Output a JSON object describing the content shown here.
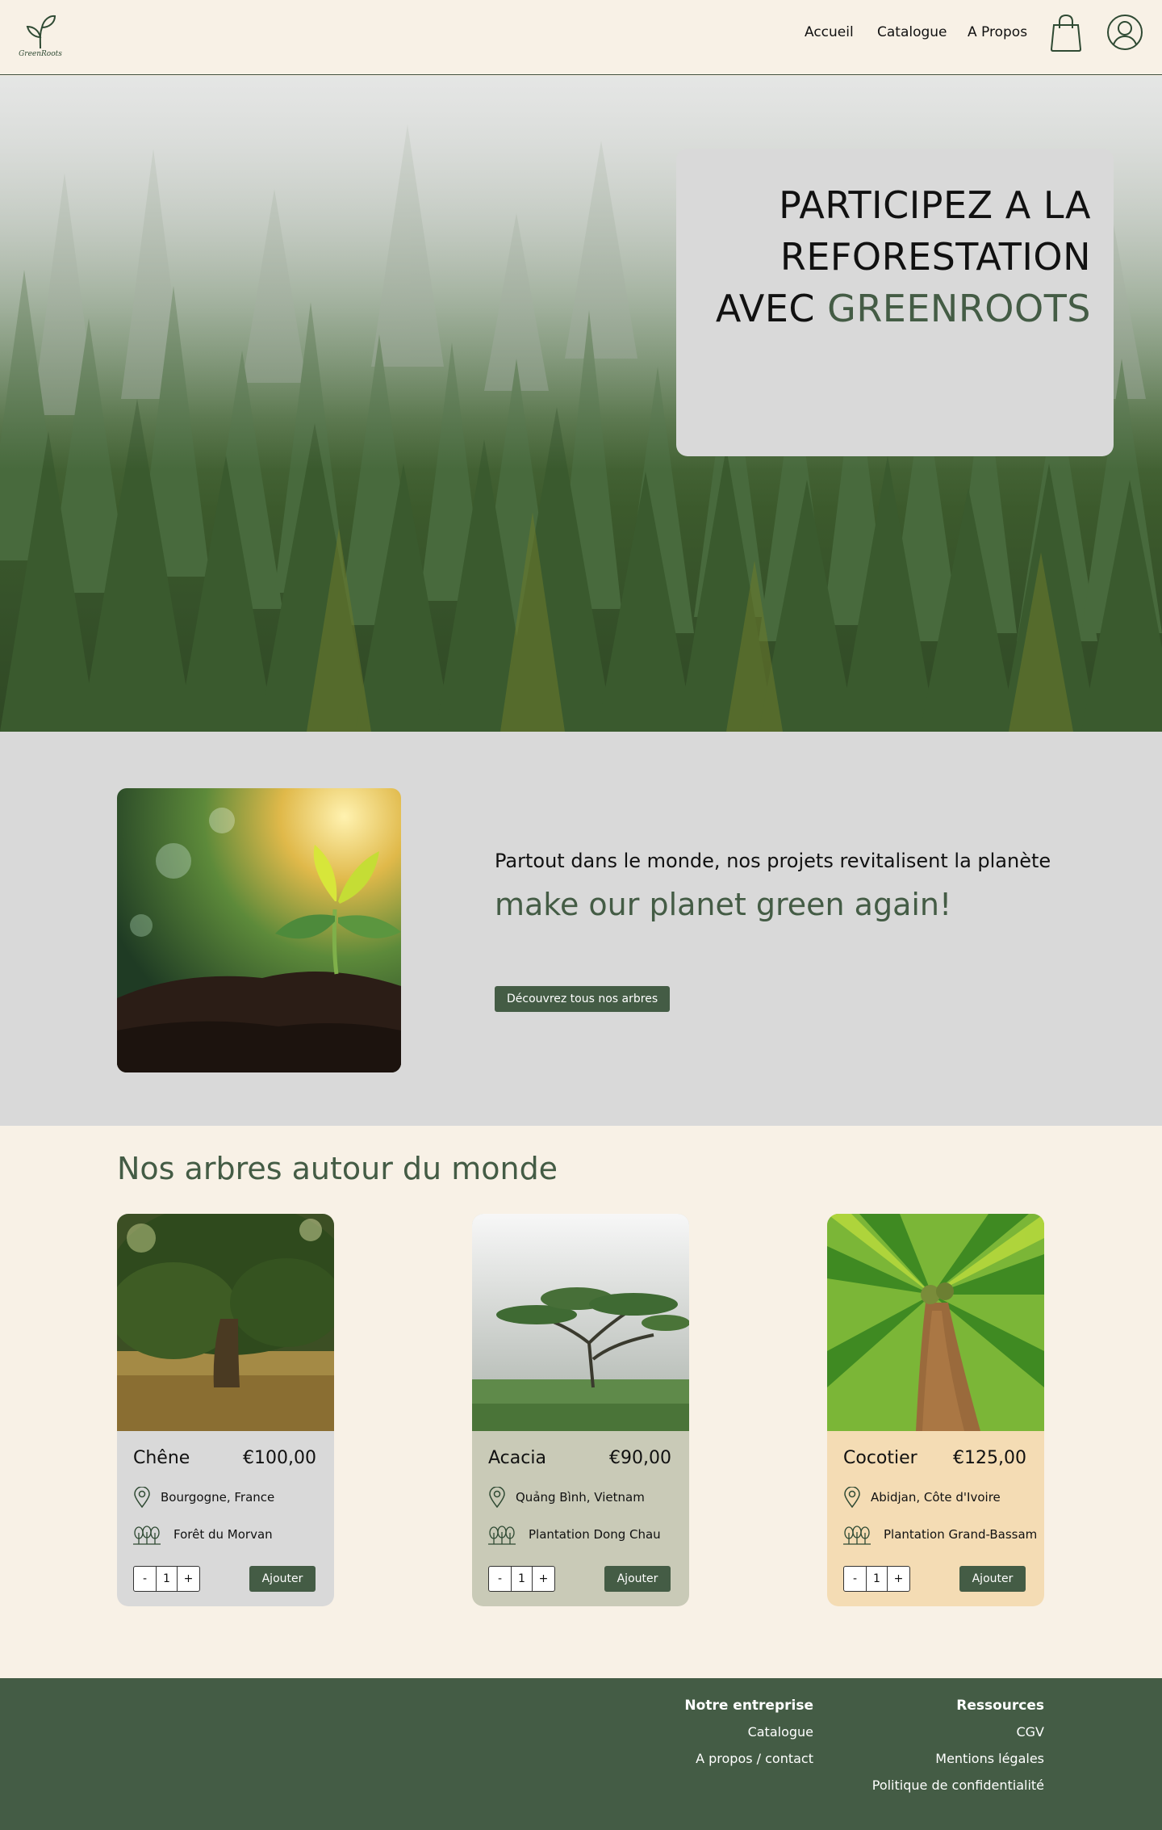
{
  "header": {
    "logo_text": "GreenRoots",
    "nav": [
      {
        "label": "Accueil"
      },
      {
        "label": "Catalogue"
      },
      {
        "label": "A Propos"
      }
    ],
    "icons": [
      "shopping-bag-icon",
      "user-account-icon"
    ]
  },
  "hero": {
    "title_line1": "PARTICIPEZ A LA",
    "title_line2": "REFORESTATION",
    "title_line3_prefix": "AVEC ",
    "title_line3_accent": "GREENROOTS"
  },
  "intro": {
    "text": "Partout dans le monde, nos projets revitalisent la planète",
    "slogan": "make our planet green again!",
    "button_label": "Découvrez tous nos arbres"
  },
  "trees": {
    "section_title": "Nos arbres autour du monde",
    "cards": [
      {
        "name": "Chêne",
        "price": "€100,00",
        "location": "Bourgogne, France",
        "forest": "Forêt du Morvan",
        "quantity": "1",
        "minus": "-",
        "plus": "+",
        "add_label": "Ajouter",
        "bg_color": "#d9d9d9"
      },
      {
        "name": "Acacia",
        "price": "€90,00",
        "location": "Quảng Bình, Vietnam",
        "forest": "Plantation Dong Chau",
        "quantity": "1",
        "minus": "-",
        "plus": "+",
        "add_label": "Ajouter",
        "bg_color": "#c9cab7"
      },
      {
        "name": "Cocotier",
        "price": "€125,00",
        "location": "Abidjan, Côte d'Ivoire",
        "forest": "Plantation Grand-Bassam",
        "quantity": "1",
        "minus": "-",
        "plus": "+",
        "add_label": "Ajouter",
        "bg_color": "#f4dcb4"
      }
    ]
  },
  "footer": {
    "col1": {
      "heading": "Notre entreprise",
      "links": [
        "Catalogue",
        "A propos / contact"
      ]
    },
    "col2": {
      "heading": "Ressources",
      "links": [
        "CGV",
        "Mentions légales",
        "Politique de confidentialité"
      ]
    }
  },
  "colors": {
    "brand_green": "#445c45",
    "background": "#f8f1e6",
    "panel_gray": "#d9d9d9"
  }
}
